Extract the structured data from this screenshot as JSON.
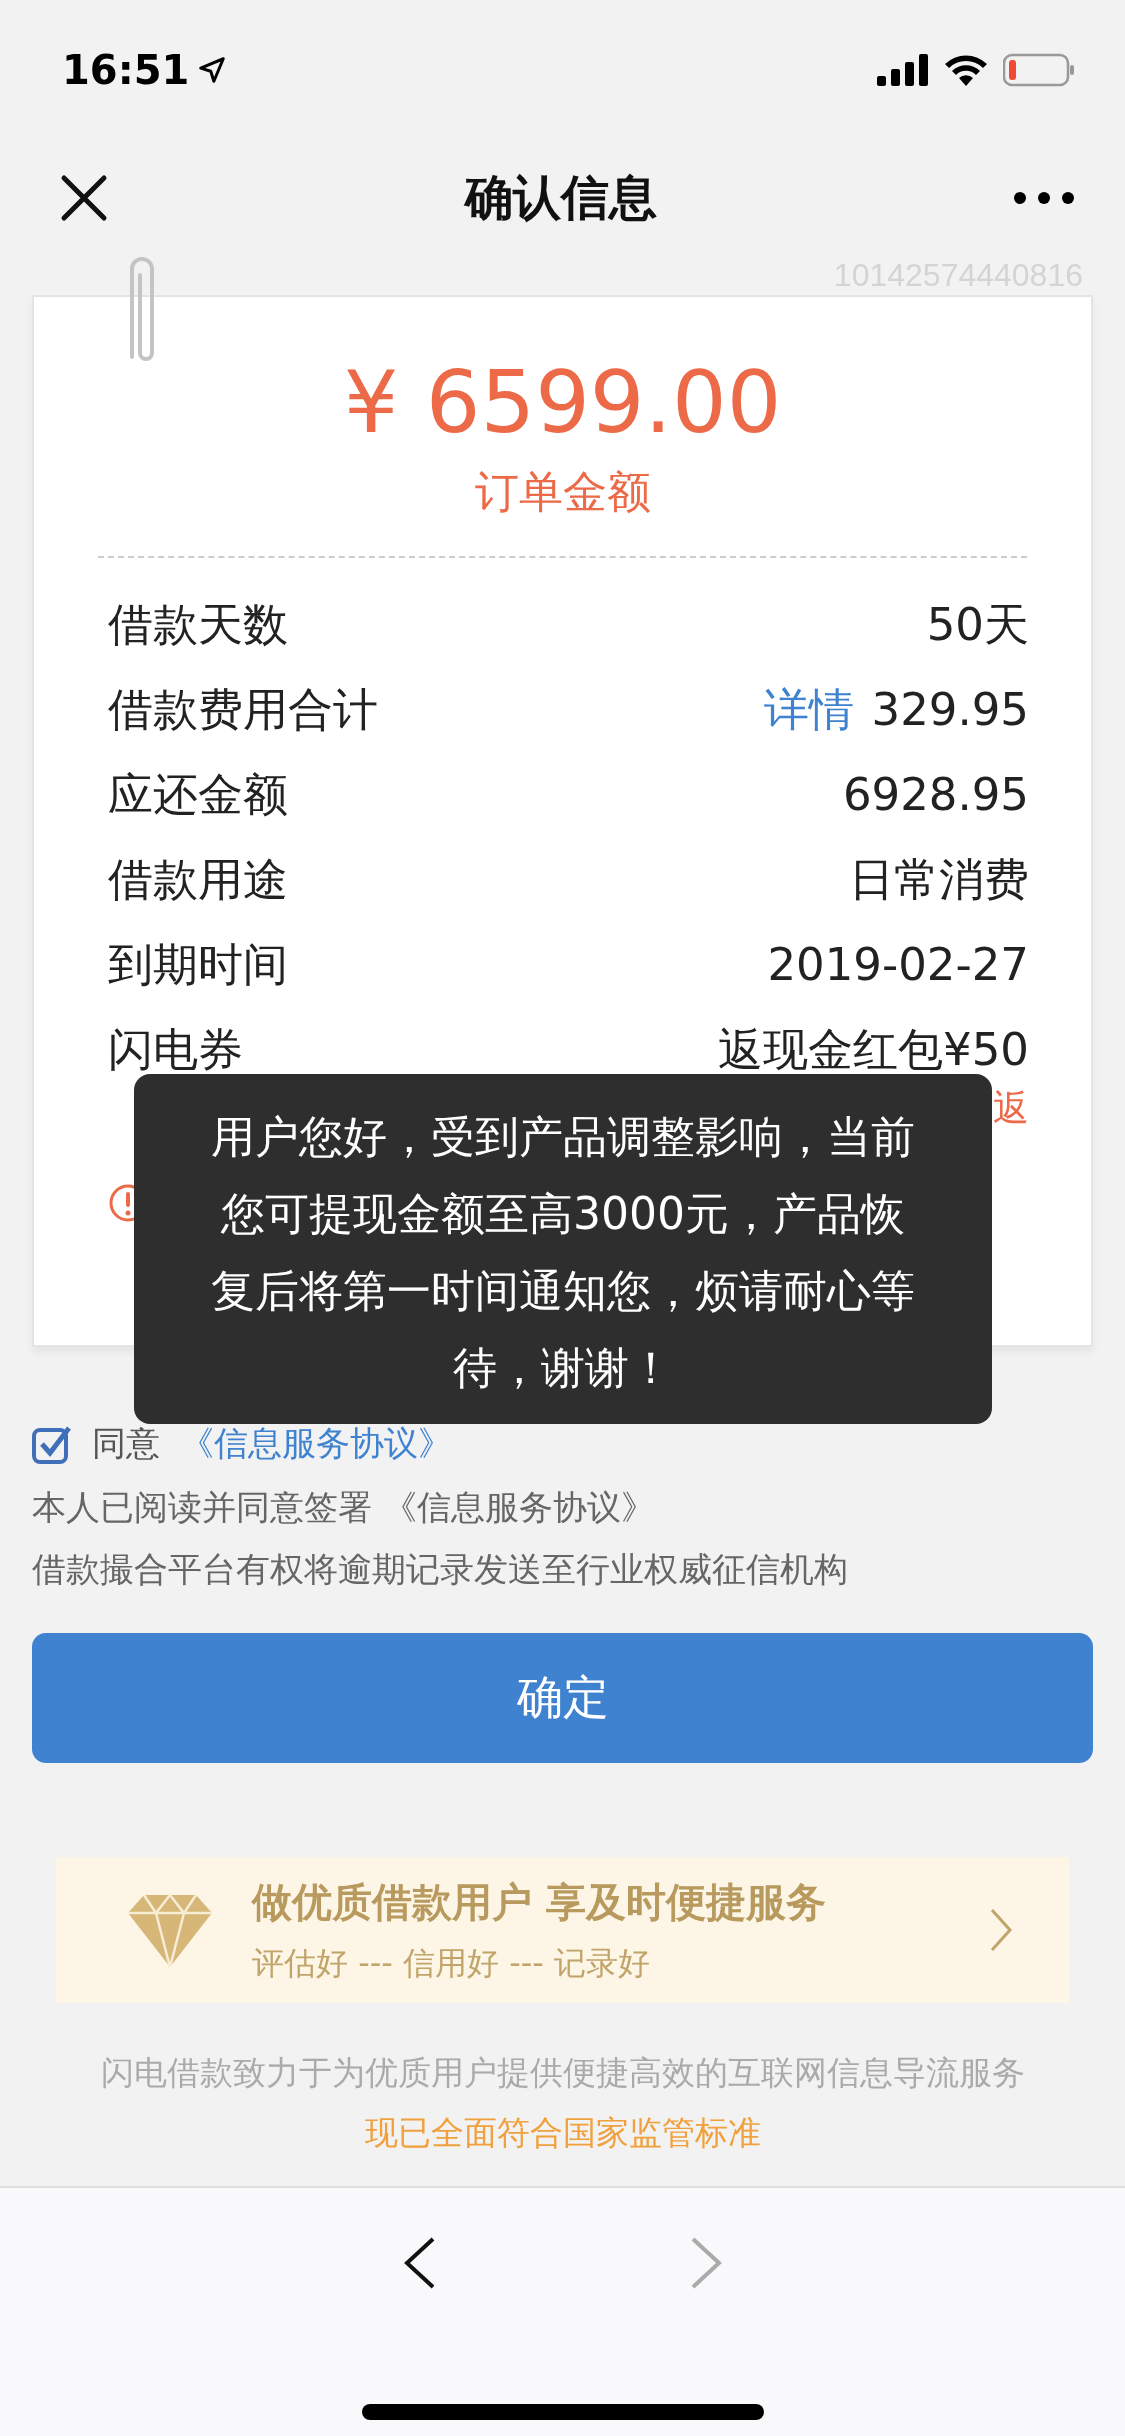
{
  "status_bar": {
    "time": "16:51"
  },
  "header": {
    "title": "确认信息"
  },
  "order_number": "10142574440816",
  "order": {
    "amount": "¥ 6599.00",
    "amount_label": "订单金额",
    "rows": [
      {
        "label": "借款天数",
        "value": "50天"
      },
      {
        "label": "借款费用合计",
        "link": "详情",
        "value": "329.95"
      },
      {
        "label": "应还金额",
        "value": "6928.95"
      },
      {
        "label": "借款用途",
        "value": "日常消费"
      },
      {
        "label": "到期时间",
        "value": "2019-02-27"
      },
      {
        "label": "闪电券",
        "value": "返现金红包¥50",
        "note": "返"
      }
    ]
  },
  "toast": {
    "message": "用户您好，受到产品调整影响，当前您可提现金额至高3000元，产品恢复后将第一时间通知您，烦请耐心等待，谢谢！"
  },
  "agreement": {
    "checked": true,
    "label": "同意",
    "link": "《信息服务协议》",
    "lines": [
      "本人已阅读并同意签署 《信息服务协议》",
      "借款撮合平台有权将逾期记录发送至行业权威征信机构"
    ]
  },
  "confirm_button": "确定",
  "banner": {
    "title": "做优质借款用户 享及时便捷服务",
    "subtitle": "评估好 --- 信用好 --- 记录好"
  },
  "footer": [
    {
      "kind": "plain",
      "text": "闪电借款致力于为优质用户提供便捷高效的互联网信息导流服务"
    },
    {
      "kind": "highlight",
      "text": "现已全面符合国家监管标准"
    }
  ],
  "browser_bar": {
    "back_enabled": true,
    "forward_enabled": false
  }
}
